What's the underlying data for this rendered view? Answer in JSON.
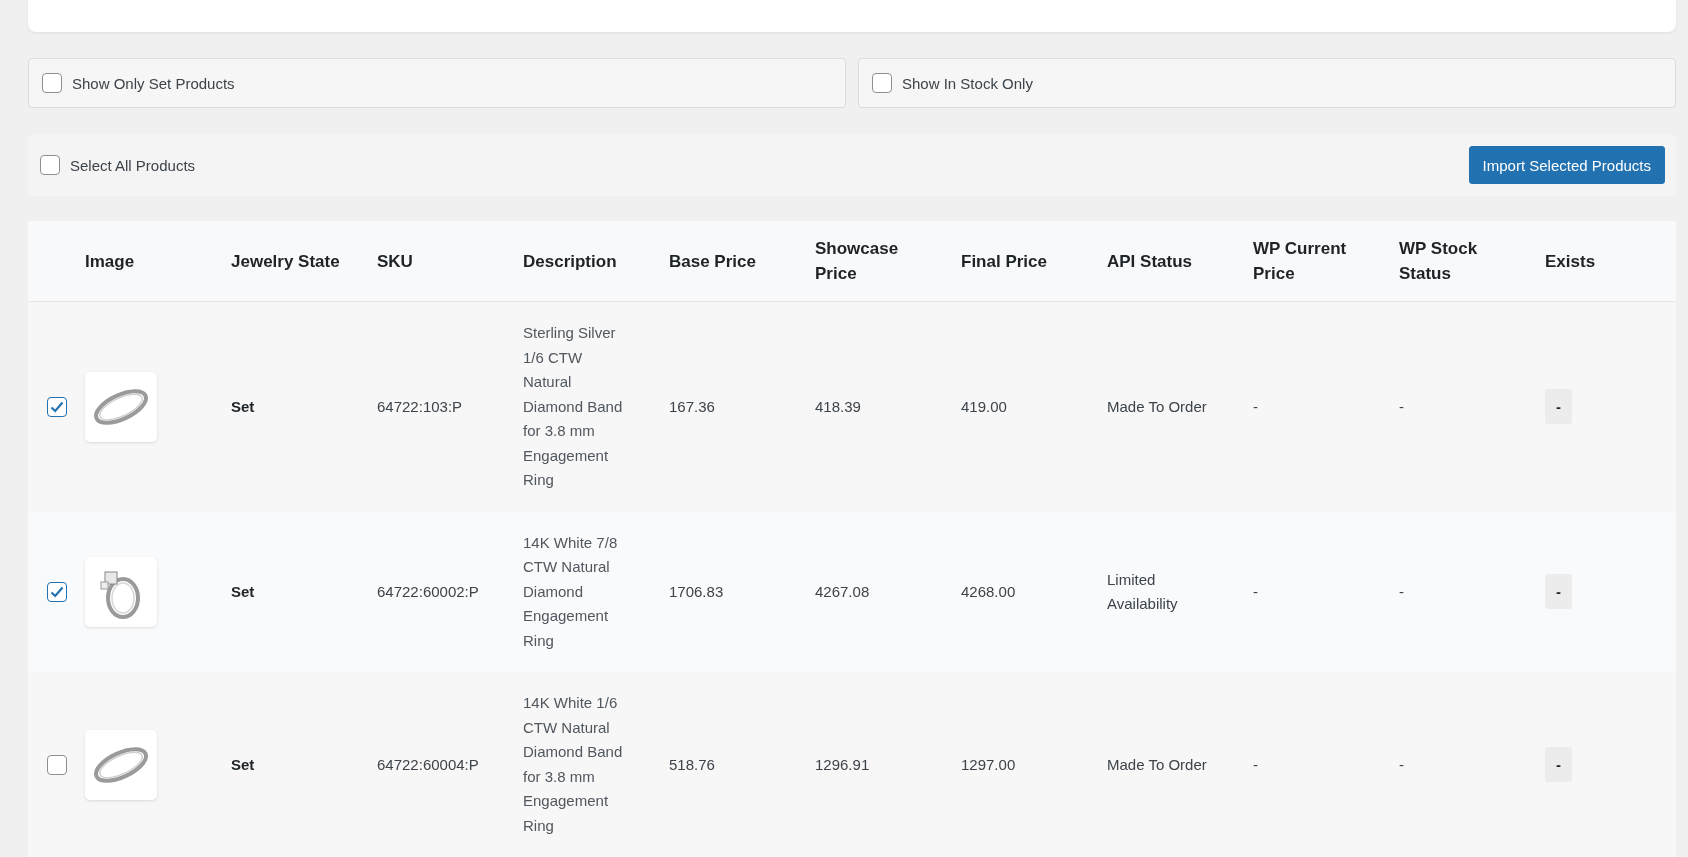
{
  "filters": [
    {
      "label": "Show Only Set Products",
      "checked": false
    },
    {
      "label": "Show In Stock Only",
      "checked": false
    }
  ],
  "toolbar": {
    "select_all": {
      "label": "Select All Products",
      "checked": false
    },
    "import_button": "Import Selected Products"
  },
  "table": {
    "columns": [
      "Image",
      "Jewelry State",
      "SKU",
      "Description",
      "Base Price",
      "Showcase Price",
      "Final Price",
      "API Status",
      "WP Current Price",
      "WP Stock Status",
      "Exists"
    ],
    "rows": [
      {
        "checked": true,
        "kind": "band",
        "jewelry_state": "Set",
        "sku": "64722:103:P",
        "description": "Sterling Silver 1/6 CTW Natural Diamond Band for 3.8 mm Engagement Ring",
        "base_price": "167.36",
        "showcase_price": "418.39",
        "final_price": "419.00",
        "api_status": "Made To Order",
        "wp_current_price": "-",
        "wp_stock_status": "-",
        "exists": "-"
      },
      {
        "checked": true,
        "kind": "solitaire",
        "jewelry_state": "Set",
        "sku": "64722:60002:P",
        "description": "14K White 7/8 CTW Natural Diamond Engagement Ring",
        "base_price": "1706.83",
        "showcase_price": "4267.08",
        "final_price": "4268.00",
        "api_status": "Limited Availability",
        "wp_current_price": "-",
        "wp_stock_status": "-",
        "exists": "-"
      },
      {
        "checked": false,
        "kind": "band",
        "jewelry_state": "Set",
        "sku": "64722:60004:P",
        "description": "14K White 1/6 CTW Natural Diamond Band for 3.8 mm Engagement Ring",
        "base_price": "518.76",
        "showcase_price": "1296.91",
        "final_price": "1297.00",
        "api_status": "Made To Order",
        "wp_current_price": "-",
        "wp_stock_status": "-",
        "exists": "-"
      }
    ]
  }
}
